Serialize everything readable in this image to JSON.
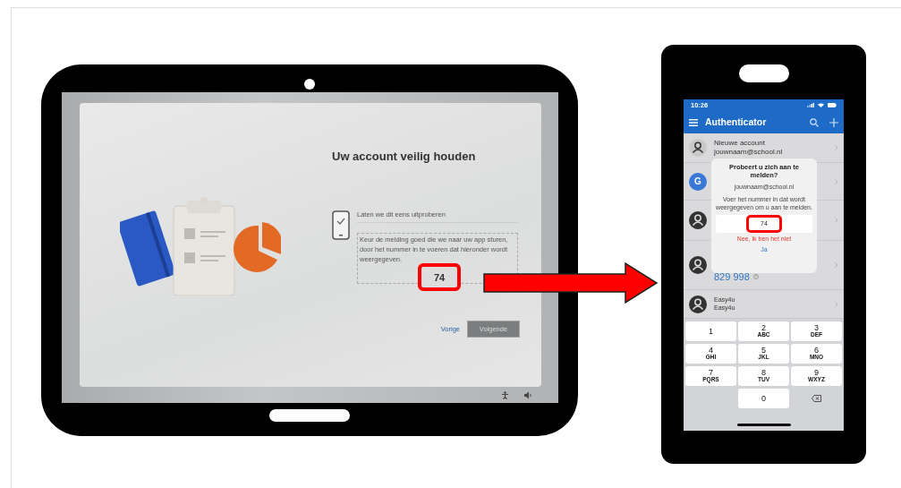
{
  "tablet": {
    "screen": {
      "title": "Uw account veilig houden",
      "step_label": "Laten we dit eens uitproberen",
      "instruction": "Keur de melding goed die we naar uw app sturen, door het nummer in te voeren dat hieronder wordt weergegeven.",
      "number": "74",
      "number_highlighted": true,
      "buttons": [
        {
          "label": "Vorige",
          "kind": "link",
          "disabled": false
        },
        {
          "label": "Volgende",
          "kind": "primary",
          "disabled": true
        }
      ]
    }
  },
  "phone": {
    "status_bar": {
      "time": "10:26"
    },
    "header": {
      "title": "Authenticator"
    },
    "accounts": [
      {
        "avatar": {
          "kind": "outline"
        },
        "name": "Nieuwe account",
        "detail": "jouwnaam@school.nl"
      },
      {
        "avatar": {
          "kind": "letter",
          "letter": "G"
        }
      },
      {
        "avatar": {
          "kind": "filled"
        }
      },
      {
        "avatar": {
          "kind": "filled"
        },
        "code": "829 998"
      },
      {
        "avatar": {
          "kind": "filled"
        },
        "name": "Easy4u",
        "detail": "Easy4u"
      }
    ],
    "dialog": {
      "title": "Probeert u zich aan te melden?",
      "account": "jouwnaam@school.nl",
      "prompt": "Voer het nummer in dat wordt weergegeven om u aan te melden.",
      "value": "74",
      "highlighted": true,
      "deny": "Nee, ik ben het niet",
      "confirm": "Ja"
    },
    "keypad": [
      {
        "kind": "digit",
        "digit": "1"
      },
      {
        "kind": "digit",
        "digit": "2",
        "letters": "ABC"
      },
      {
        "kind": "digit",
        "digit": "3",
        "letters": "DEF"
      },
      {
        "kind": "digit",
        "digit": "4",
        "letters": "GHI"
      },
      {
        "kind": "digit",
        "digit": "5",
        "letters": "JKL"
      },
      {
        "kind": "digit",
        "digit": "6",
        "letters": "MNO"
      },
      {
        "kind": "digit",
        "digit": "7",
        "letters": "PQRS"
      },
      {
        "kind": "digit",
        "digit": "8",
        "letters": "TUV"
      },
      {
        "kind": "digit",
        "digit": "9",
        "letters": "WXYZ"
      },
      {
        "kind": "blank"
      },
      {
        "kind": "digit",
        "digit": "0"
      },
      {
        "kind": "backspace"
      }
    ]
  }
}
